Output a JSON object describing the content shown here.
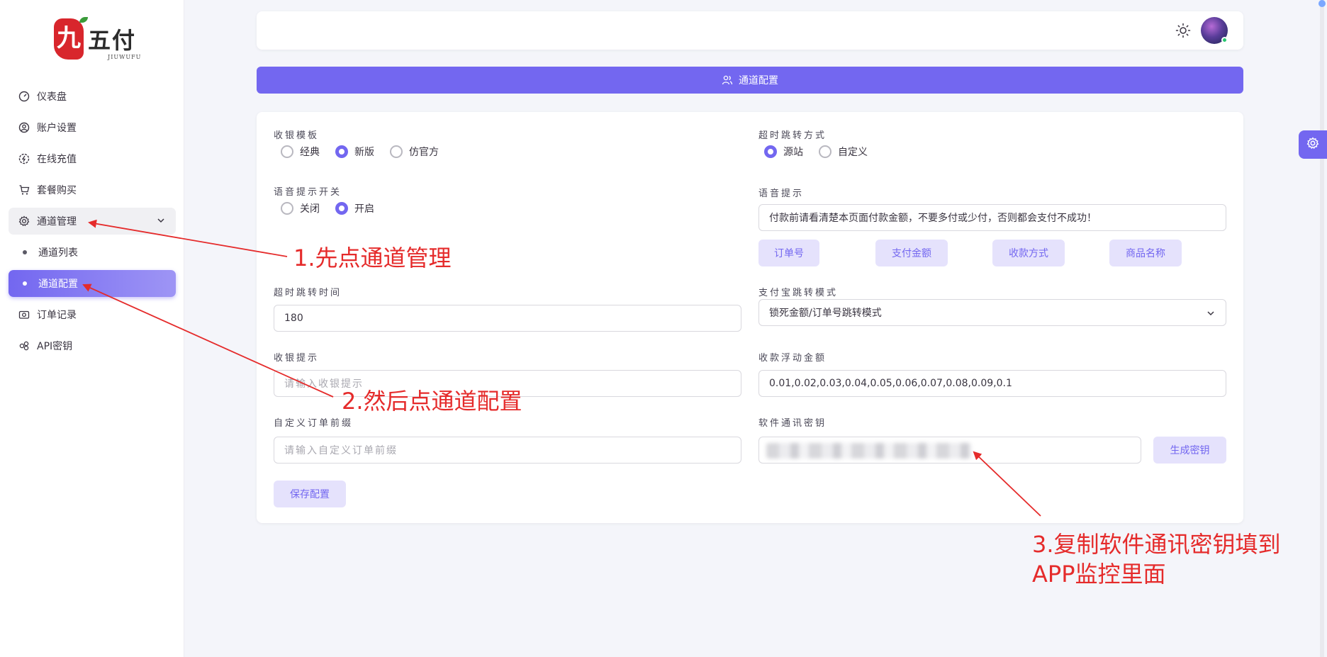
{
  "brand": {
    "logo_char": "九",
    "name": "五付",
    "name_en": "JIUWUFU"
  },
  "sidebar": {
    "items": [
      {
        "label": "仪表盘",
        "icon": "gauge-icon"
      },
      {
        "label": "账户设置",
        "icon": "user-circle-icon"
      },
      {
        "label": "在线充值",
        "icon": "recharge-icon"
      },
      {
        "label": "套餐购买",
        "icon": "cart-icon"
      },
      {
        "label": "通道管理",
        "icon": "gear-icon"
      },
      {
        "label": "通道列表",
        "icon": "dot"
      },
      {
        "label": "通道配置",
        "icon": "dot"
      },
      {
        "label": "订单记录",
        "icon": "camera-icon"
      },
      {
        "label": "API密钥",
        "icon": "link-icon"
      }
    ]
  },
  "header": {
    "title": "通道配置"
  },
  "form": {
    "checkout_template": {
      "label": "收银模板",
      "options": [
        "经典",
        "新版",
        "仿官方"
      ],
      "selected": "新版"
    },
    "timeout_redirect_mode": {
      "label": "超时跳转方式",
      "options": [
        "源站",
        "自定义"
      ],
      "selected": "源站"
    },
    "voice_switch": {
      "label": "语音提示开关",
      "options": [
        "关闭",
        "开启"
      ],
      "selected": "开启"
    },
    "voice_prompt": {
      "label": "语音提示",
      "value": "付款前请看清楚本页面付款金额，不要多付或少付，否则都会支付不成功！"
    },
    "voice_tags": [
      "订单号",
      "支付金额",
      "收款方式",
      "商品名称"
    ],
    "timeout_time": {
      "label": "超时跳转时间",
      "value": "180"
    },
    "alipay_mode": {
      "label": "支付宝跳转模式",
      "value": "锁死金额/订单号跳转模式"
    },
    "checkout_tip": {
      "label": "收银提示",
      "placeholder": "请输入收银提示"
    },
    "float_amount": {
      "label": "收款浮动金额",
      "value": "0.01,0.02,0.03,0.04,0.05,0.06,0.07,0.08,0.09,0.1"
    },
    "order_prefix": {
      "label": "自定义订单前缀",
      "placeholder": "请输入自定义订单前缀"
    },
    "secret_key": {
      "label": "软件通讯密钥",
      "generate_label": "生成密钥"
    },
    "save_label": "保存配置"
  },
  "annotations": {
    "step1": "1.先点通道管理",
    "step2": "2.然后点通道配置",
    "step3_line1": "3.复制软件通讯密钥填到",
    "step3_line2": "APP监控里面"
  },
  "colors": {
    "accent": "#7367f0",
    "annotation": "#e52b2b"
  }
}
